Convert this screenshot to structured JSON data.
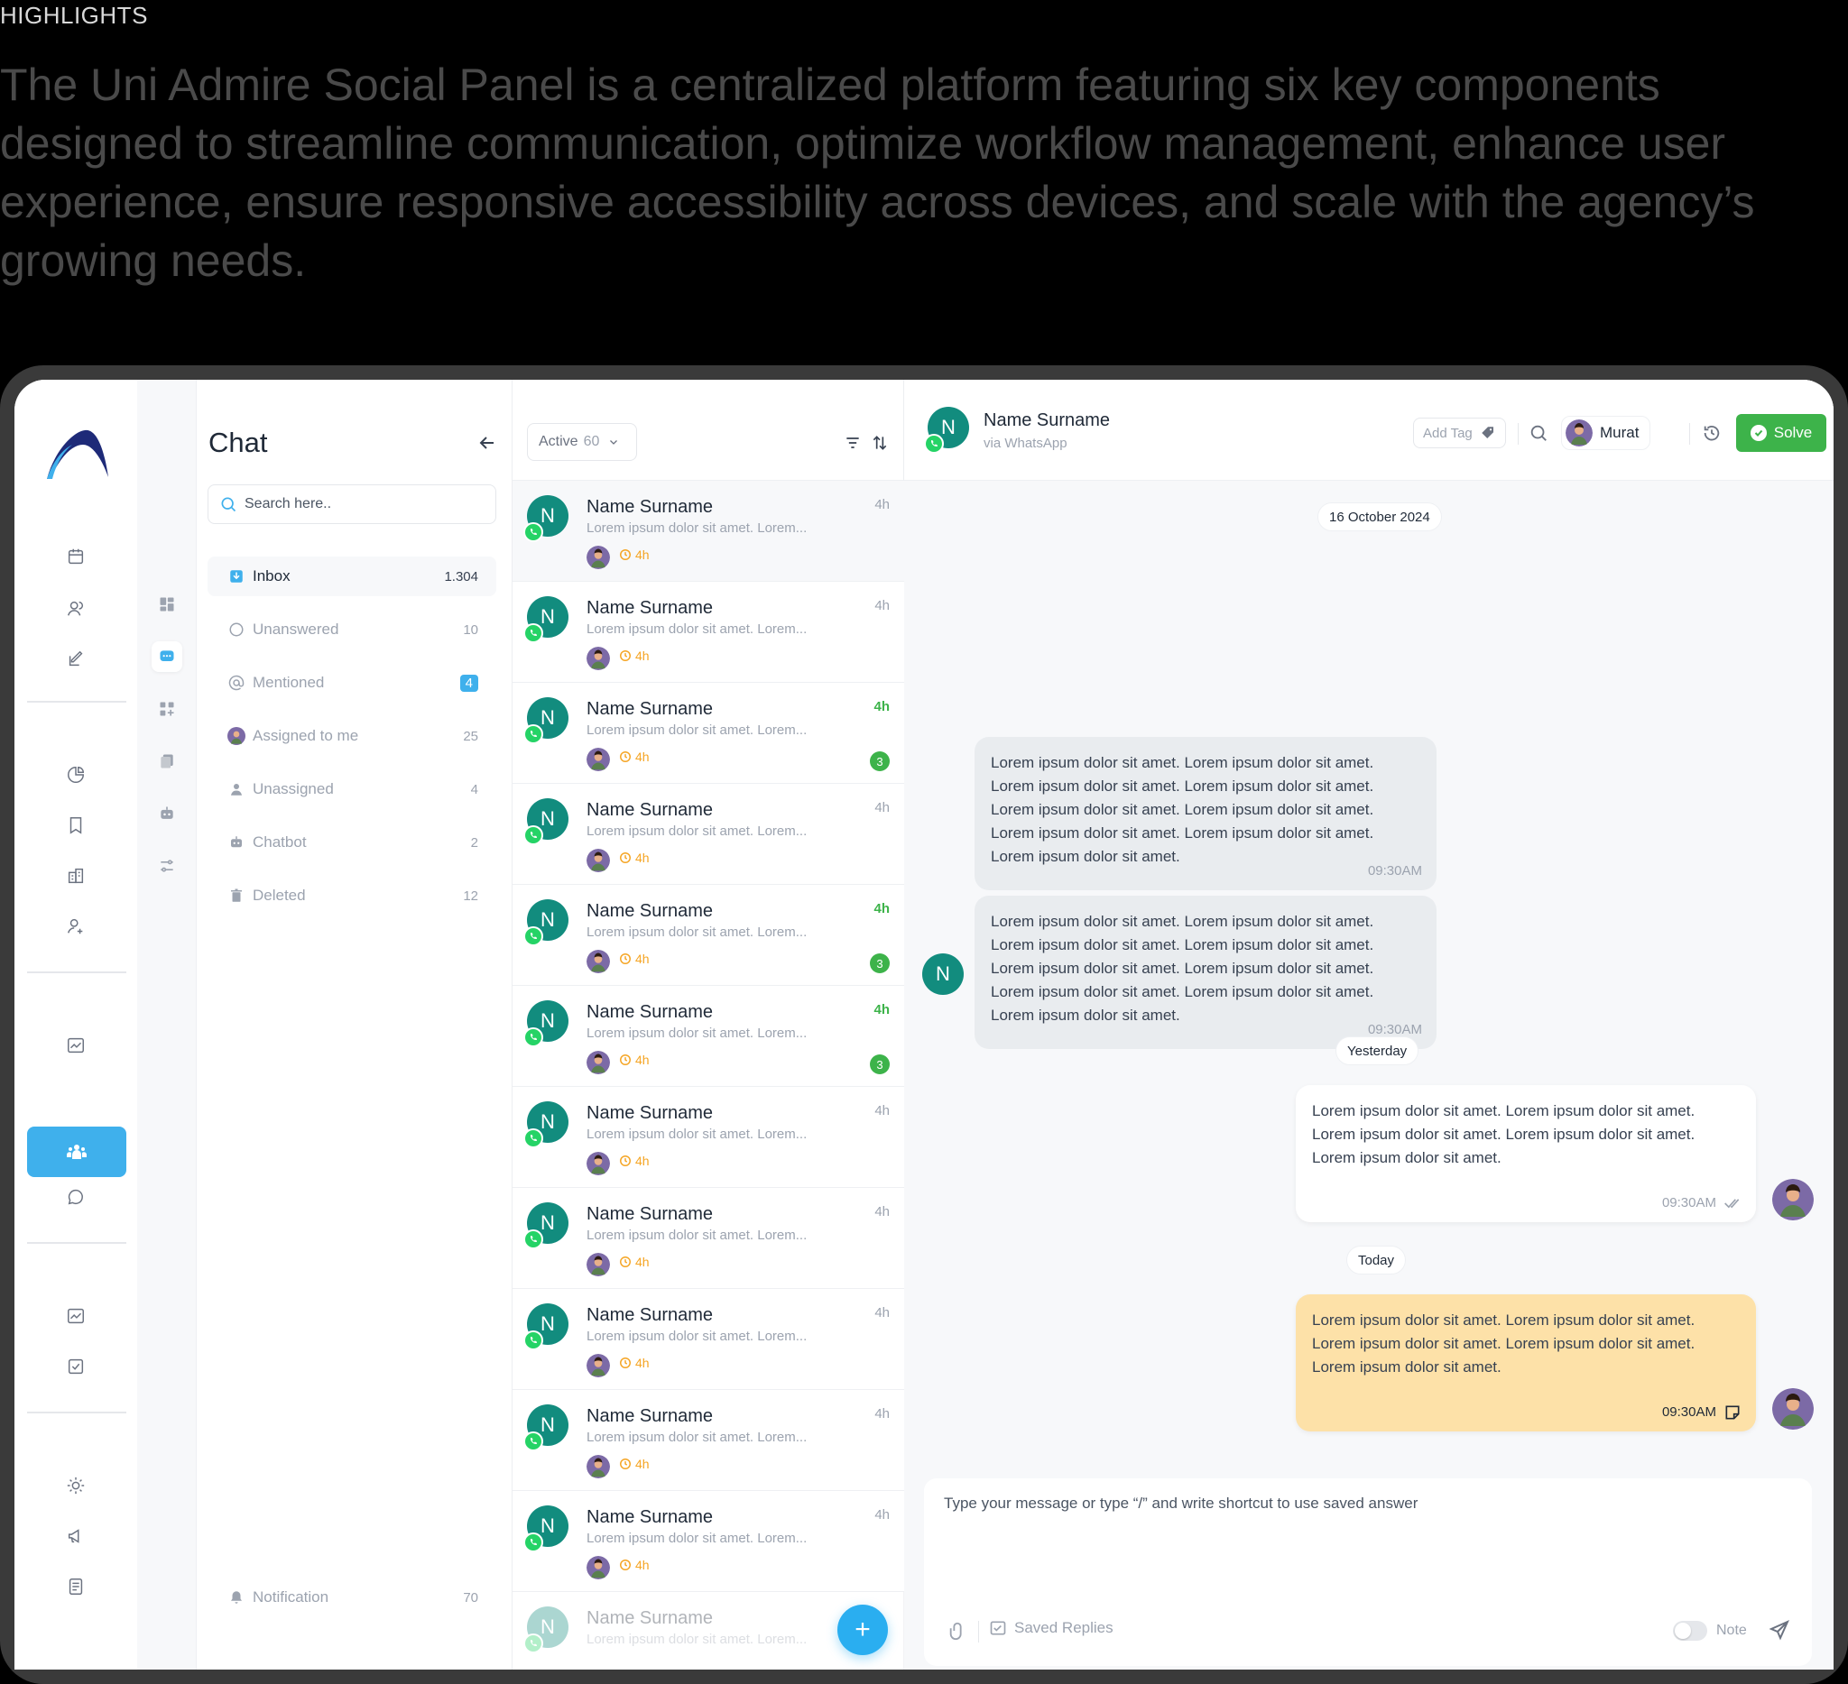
{
  "highlights": {
    "label": "HIGHLIGHTS",
    "text": "The Uni Admire Social Panel is a centralized platform featuring six key components designed to streamline communication, optimize workflow management, enhance user experience, ensure responsive accessibility across devices, and scale with the agency’s growing needs."
  },
  "panel": {
    "title": "Chat",
    "search_placeholder": "Search here..",
    "folders": [
      {
        "icon": "inbox-icon",
        "label": "Inbox",
        "count": "1.304",
        "active": true
      },
      {
        "icon": "circle-icon",
        "label": "Unanswered",
        "count": "10"
      },
      {
        "icon": "at-icon",
        "label": "Mentioned",
        "count": "4",
        "badge": true
      },
      {
        "icon": "avatar-icon",
        "label": "Assigned to me",
        "count": "25"
      },
      {
        "icon": "user-icon",
        "label": "Unassigned",
        "count": "4"
      },
      {
        "icon": "robot-icon",
        "label": "Chatbot",
        "count": "2"
      },
      {
        "icon": "trash-icon",
        "label": "Deleted",
        "count": "12"
      }
    ],
    "notification": {
      "label": "Notification",
      "count": "70"
    }
  },
  "list": {
    "status": "Active",
    "status_count": "60",
    "conversations": [
      {
        "initial": "N",
        "name": "Name Surname",
        "preview": "Lorem ipsum dolor sit amet. Lorem...",
        "time": "4h",
        "wait": "4h",
        "selected": true
      },
      {
        "initial": "N",
        "name": "Name Surname",
        "preview": "Lorem ipsum dolor sit amet. Lorem...",
        "time": "4h",
        "wait": "4h"
      },
      {
        "initial": "N",
        "name": "Name Surname",
        "preview": "Lorem ipsum dolor sit amet. Lorem...",
        "time": "4h",
        "wait": "4h",
        "unread": "3"
      },
      {
        "initial": "N",
        "name": "Name Surname",
        "preview": "Lorem ipsum dolor sit amet. Lorem...",
        "time": "4h",
        "wait": "4h"
      },
      {
        "initial": "N",
        "name": "Name Surname",
        "preview": "Lorem ipsum dolor sit amet. Lorem...",
        "time": "4h",
        "wait": "4h",
        "unread": "3"
      },
      {
        "initial": "N",
        "name": "Name Surname",
        "preview": "Lorem ipsum dolor sit amet. Lorem...",
        "time": "4h",
        "wait": "4h",
        "unread": "3"
      },
      {
        "initial": "N",
        "name": "Name Surname",
        "preview": "Lorem ipsum dolor sit amet. Lorem...",
        "time": "4h",
        "wait": "4h"
      },
      {
        "initial": "N",
        "name": "Name Surname",
        "preview": "Lorem ipsum dolor sit amet. Lorem...",
        "time": "4h",
        "wait": "4h"
      },
      {
        "initial": "N",
        "name": "Name Surname",
        "preview": "Lorem ipsum dolor sit amet. Lorem...",
        "time": "4h",
        "wait": "4h"
      },
      {
        "initial": "N",
        "name": "Name Surname",
        "preview": "Lorem ipsum dolor sit amet. Lorem...",
        "time": "4h",
        "wait": "4h"
      },
      {
        "initial": "N",
        "name": "Name Surname",
        "preview": "Lorem ipsum dolor sit amet. Lorem...",
        "time": "4h",
        "wait": "4h"
      },
      {
        "initial": "N",
        "name": "Name Surname",
        "preview": "Lorem ipsum dolor sit amet. Lorem...",
        "time": "",
        "wait": "",
        "faded": true
      }
    ],
    "fab": "+"
  },
  "chat": {
    "contact_initial": "N",
    "contact_name": "Name Surname",
    "channel": "via WhatsApp",
    "add_tag": "Add Tag",
    "agent": "Murat",
    "solve": "Solve",
    "dates": {
      "first": "16 October 2024",
      "yesterday": "Yesterday",
      "today": "Today"
    },
    "messages": [
      {
        "text": "Lorem ipsum dolor sit amet. Lorem ipsum dolor sit amet. Lorem ipsum dolor sit amet. Lorem ipsum dolor sit amet. Lorem ipsum dolor sit amet. Lorem ipsum dolor sit amet. Lorem ipsum dolor sit amet. Lorem ipsum dolor sit amet. Lorem ipsum dolor sit amet.",
        "time": "09:30AM"
      },
      {
        "text": "Lorem ipsum dolor sit amet. Lorem ipsum dolor sit amet. Lorem ipsum dolor sit amet. Lorem ipsum dolor sit amet. Lorem ipsum dolor sit amet. Lorem ipsum dolor sit amet. Lorem ipsum dolor sit amet. Lorem ipsum dolor sit amet. Lorem ipsum dolor sit amet.",
        "time": "09:30AM"
      },
      {
        "text": "Lorem ipsum dolor sit amet. Lorem ipsum dolor sit amet. Lorem ipsum dolor sit amet. Lorem ipsum dolor sit amet. Lorem ipsum dolor sit amet.",
        "time": "09:30AM"
      },
      {
        "text": "Lorem ipsum dolor sit amet. Lorem ipsum dolor sit amet. Lorem ipsum dolor sit amet. Lorem ipsum dolor sit amet. Lorem ipsum dolor sit amet.",
        "time": "09:30AM"
      }
    ],
    "composer_placeholder": "Type your message or type “/” and write shortcut to use saved answer",
    "saved_replies": "Saved Replies",
    "note": "Note"
  },
  "colors": {
    "accent": "#3fb0ec",
    "whatsapp": "#25d366",
    "avatar": "#128c7e",
    "solve": "#3db34a",
    "note": "#fde1a8"
  }
}
